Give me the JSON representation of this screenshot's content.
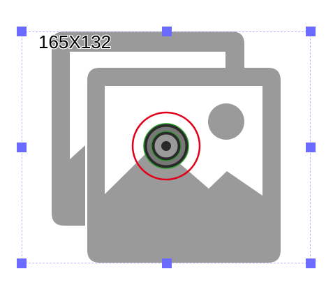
{
  "overlay": {
    "dimensions_label": "165X132"
  },
  "colors": {
    "image_icon_gray": "#9a9a9a",
    "selection_dash": "#b8b8ff",
    "handle_fill": "#6b6bff",
    "target_ring_red": "#e0001a",
    "target_ring_green": "#2e9e2e",
    "target_center_dark": "#2a2a2a",
    "background": "#ffffff"
  },
  "icons": {
    "image": "photo-library-icon",
    "target": "crosshair-target-icon"
  }
}
